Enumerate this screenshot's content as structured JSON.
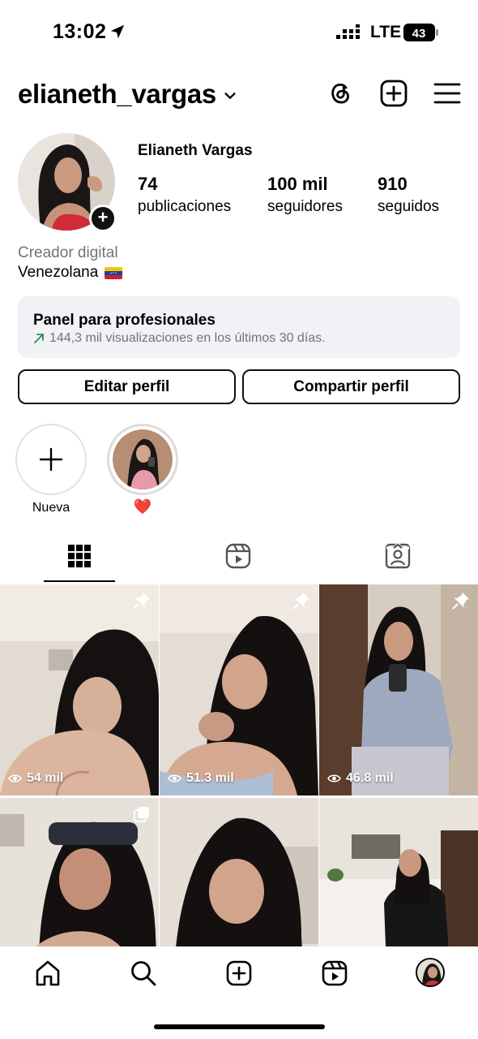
{
  "status": {
    "time": "13:02",
    "network": "LTE",
    "battery": "43"
  },
  "header": {
    "username": "elianeth_vargas",
    "icons": [
      "threads-icon",
      "create-icon",
      "menu-icon"
    ]
  },
  "profile": {
    "full_name": "Elianeth Vargas",
    "stats": [
      {
        "value": "74",
        "label": "publicaciones"
      },
      {
        "value": "100 mil",
        "label": "seguidores"
      },
      {
        "value": "910",
        "label": "seguidos"
      }
    ],
    "category": "Creador digital",
    "bio": "Venezolana"
  },
  "dashboard": {
    "title": "Panel para profesionales",
    "subtitle": "144,3 mil visualizaciones en los últimos 30 días."
  },
  "buttons": {
    "edit": "Editar perfil",
    "share": "Compartir perfil"
  },
  "highlights": [
    {
      "label": "Nueva"
    },
    {
      "label": "❤️"
    }
  ],
  "tabs": [
    "grid-icon",
    "reels-icon",
    "tagged-icon"
  ],
  "posts": [
    {
      "views": "54 mil",
      "badge": "pin-icon"
    },
    {
      "views": "51.3 mil",
      "badge": "pin-icon"
    },
    {
      "views": "46.8 mil",
      "badge": "pin-icon"
    },
    {
      "views": "",
      "badge": "carousel-icon"
    },
    {
      "views": "",
      "badge": ""
    },
    {
      "views": "",
      "badge": ""
    }
  ],
  "colors": {
    "accent": "#000000",
    "muted_text": "#737373",
    "panel_bg": "#f0f2f5",
    "trend_green": "#2e8b57"
  }
}
